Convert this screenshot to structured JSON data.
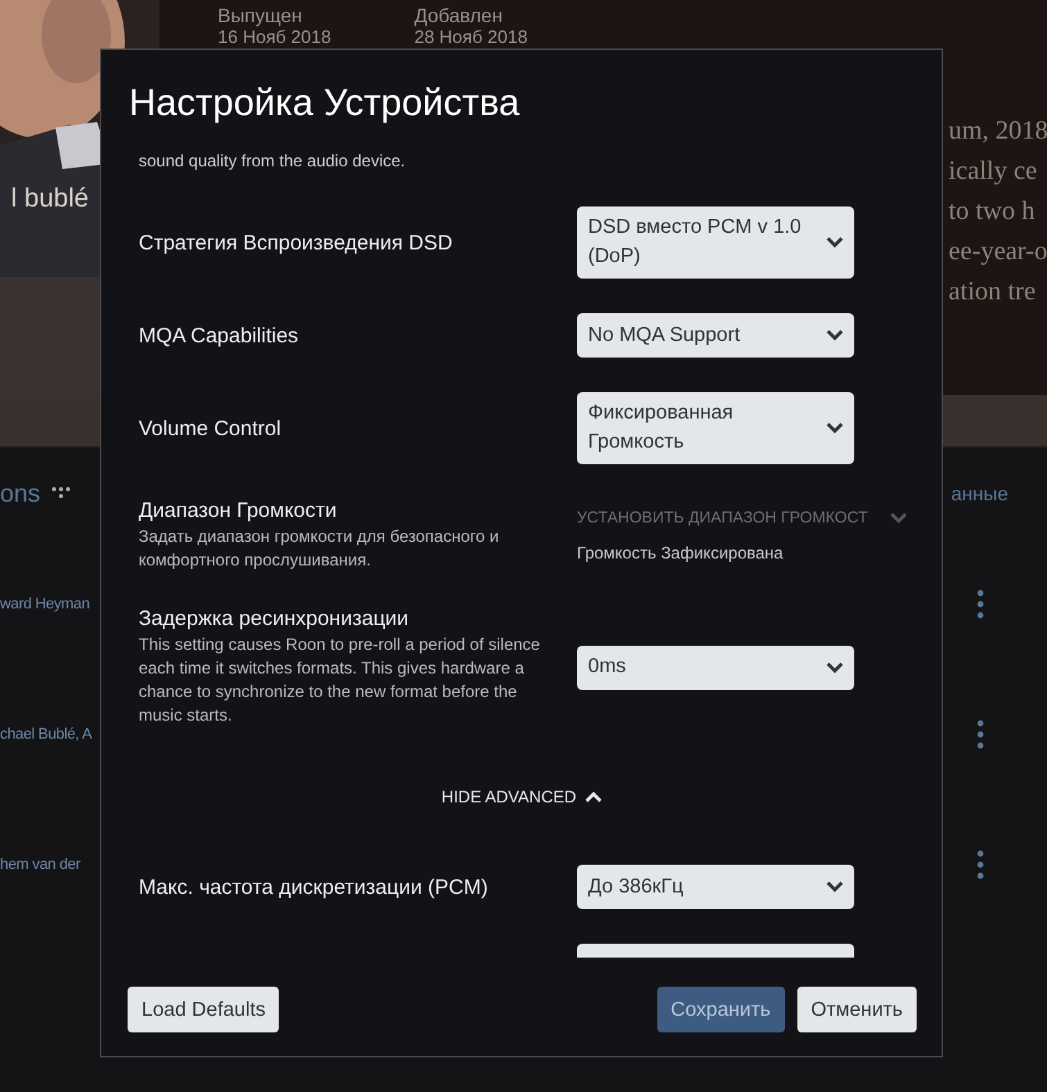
{
  "background": {
    "released_label": "Выпущен",
    "released_date": "16 Нояб 2018",
    "added_label": "Добавлен",
    "added_date": "28 Нояб 2018",
    "artist_fragment": "l bublé",
    "review_lines": [
      "um, 2018",
      "ically ce",
      "to two h",
      "ee-year-o",
      "ation tre"
    ],
    "section_title": "ons",
    "section_link": "анные",
    "credits": [
      "ward Heyman",
      "chael Bublé, A",
      "hem van der"
    ]
  },
  "dialog": {
    "title": "Настройка Устройства",
    "intro": "sound quality from the audio device.",
    "settings": [
      {
        "kind": "select",
        "label": "Стратегия Вспроизведения DSD",
        "value": "DSD вместо PCM v 1.0 (DoP)"
      },
      {
        "kind": "select",
        "label": "MQA Capabilities",
        "value": "No MQA Support"
      },
      {
        "kind": "select",
        "label": "Volume Control",
        "value": "Фиксированная Громкость"
      },
      {
        "kind": "range",
        "label": "Диапазон Громкости",
        "description": "Задать диапазон громкости для безопасного и комфортного прослушивания.",
        "action": "УСТАНОВИТЬ ДИАПАЗОН ГРОМКОСТ",
        "status": "Громкость Зафиксирована"
      },
      {
        "kind": "select",
        "label": "Задержка ресинхронизации",
        "description": "This setting causes Roon to pre-roll a period of silence each time it switches formats. This gives hardware a chance to synchronize to the new format before the music starts.",
        "value": "0ms"
      }
    ],
    "advanced_toggle": {
      "label": "HIDE ADVANCED",
      "expanded": true
    },
    "advanced_settings": [
      {
        "kind": "select",
        "label": "Макс. частота дискретизации (PCM)",
        "value": "До 386кГц"
      },
      {
        "kind": "select"
      }
    ],
    "buttons": [
      {
        "label": "Load Defaults",
        "kind": "secondary"
      },
      {
        "label": "Сохранить",
        "kind": "primary"
      },
      {
        "label": "Отменить",
        "kind": "secondary"
      }
    ]
  }
}
